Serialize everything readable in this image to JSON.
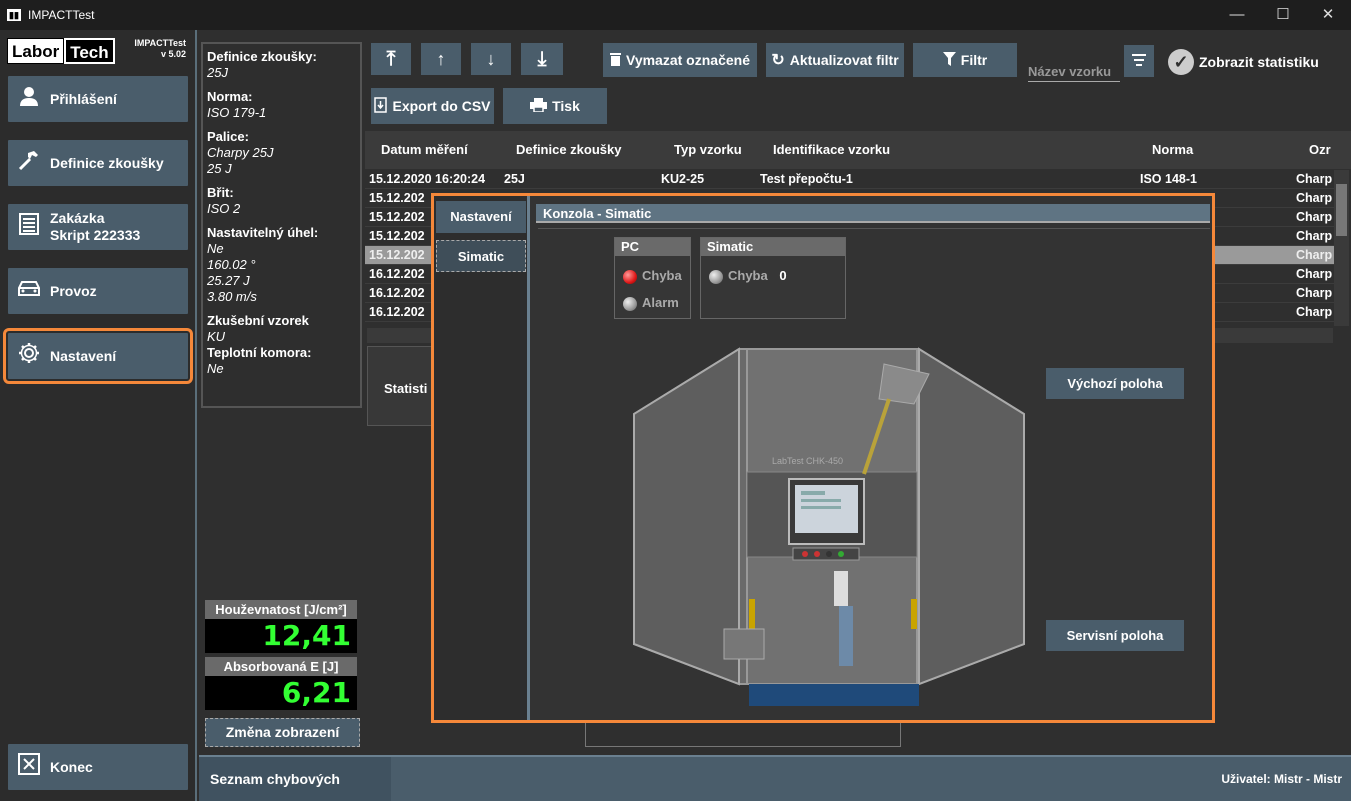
{
  "window": {
    "title": "IMPACTTest",
    "minimize": "—",
    "maximize": "☐",
    "close": "✕"
  },
  "sidebar": {
    "logo_left": "Labor",
    "logo_right": "Tech",
    "app_name": "IMPACTTest",
    "version": "v 5.02",
    "items": [
      {
        "label": "Přihlášení",
        "icon": "user-icon"
      },
      {
        "label": "Definice zkoušky",
        "icon": "hammer-icon"
      },
      {
        "label": "Zakázka",
        "label2": "Skript 222333",
        "icon": "document-icon"
      },
      {
        "label": "Provoz",
        "icon": "car-icon"
      },
      {
        "label": "Nastavení",
        "icon": "gear-icon",
        "active": true
      }
    ],
    "exit": {
      "label": "Konec",
      "icon": "close-box-icon"
    }
  },
  "info": {
    "def_label": "Definice zkoušky:",
    "def_value": "25J",
    "norm_label": "Norma:",
    "norm_value": "ISO 179-1",
    "palice_label": "Palice:",
    "palice_value1": "Charpy 25J",
    "palice_value2": "25 J",
    "brit_label": "Břit:",
    "brit_value": "ISO 2",
    "uhel_label": "Nastavitelný úhel:",
    "uhel_value1": "Ne",
    "uhel_value2": "160.02 °",
    "uhel_value3": "25.27 J",
    "uhel_value4": "3.80 m/s",
    "vzorek_label": "Zkušební vzorek",
    "vzorek_value": "KU",
    "komora_label": "Teplotní komora:",
    "komora_value": "Ne"
  },
  "meters": {
    "toughness_label": "Houževnatost [J/cm²]",
    "toughness_value": "12,41",
    "energy_label": "Absorbovaná E [J]",
    "energy_value": "6,21",
    "change_view": "Změna zobrazení"
  },
  "toolbar": {
    "first": "⤒",
    "up": "↑",
    "down": "↓",
    "last": "⤓",
    "delete": "Vymazat označené",
    "refresh": "Aktualizovat filtr",
    "filter": "Filtr",
    "sample_placeholder": "Název vzorku",
    "show_stats": "Zobrazit statistiku",
    "export": "Export do CSV",
    "print": "Tisk"
  },
  "table": {
    "columns": [
      "Datum měření",
      "Definice zkoušky",
      "Typ vzorku",
      "Identifikace vzorku",
      "Norma",
      "Ozr"
    ],
    "rows": [
      {
        "date": "15.12.2020 16:20:24",
        "def": "25J",
        "typ": "KU2-25",
        "id": "Test přepočtu-1",
        "norma": "ISO 148-1",
        "ozr": "Charp"
      },
      {
        "date": "15.12.202",
        "ozr": "Charp"
      },
      {
        "date": "15.12.202",
        "ozr": "Charp"
      },
      {
        "date": "15.12.202",
        "ozr": "Charp"
      },
      {
        "date": "15.12.202",
        "ozr": "Charp"
      },
      {
        "date": "16.12.202",
        "ozr": "Charp"
      },
      {
        "date": "16.12.202",
        "ozr": "Charp"
      },
      {
        "date": "16.12.202",
        "ozr": "Charp"
      }
    ],
    "stats_label": "Statisti"
  },
  "overlay": {
    "tabs": [
      "Nastavení",
      "Simatic"
    ],
    "console_title": "Konzola - Simatic",
    "pc": {
      "title": "PC",
      "error": "Chyba",
      "alarm": "Alarm"
    },
    "simatic": {
      "title": "Simatic",
      "error": "Chyba",
      "error_count": "0"
    },
    "home_btn": "Výchozí poloha",
    "service_btn": "Servisní poloha",
    "machine_label": "LabTest CHK-450"
  },
  "statusbar": {
    "errors": "Seznam chybových hlášení",
    "user": "Uživatel: Mistr  -  Mistr"
  }
}
